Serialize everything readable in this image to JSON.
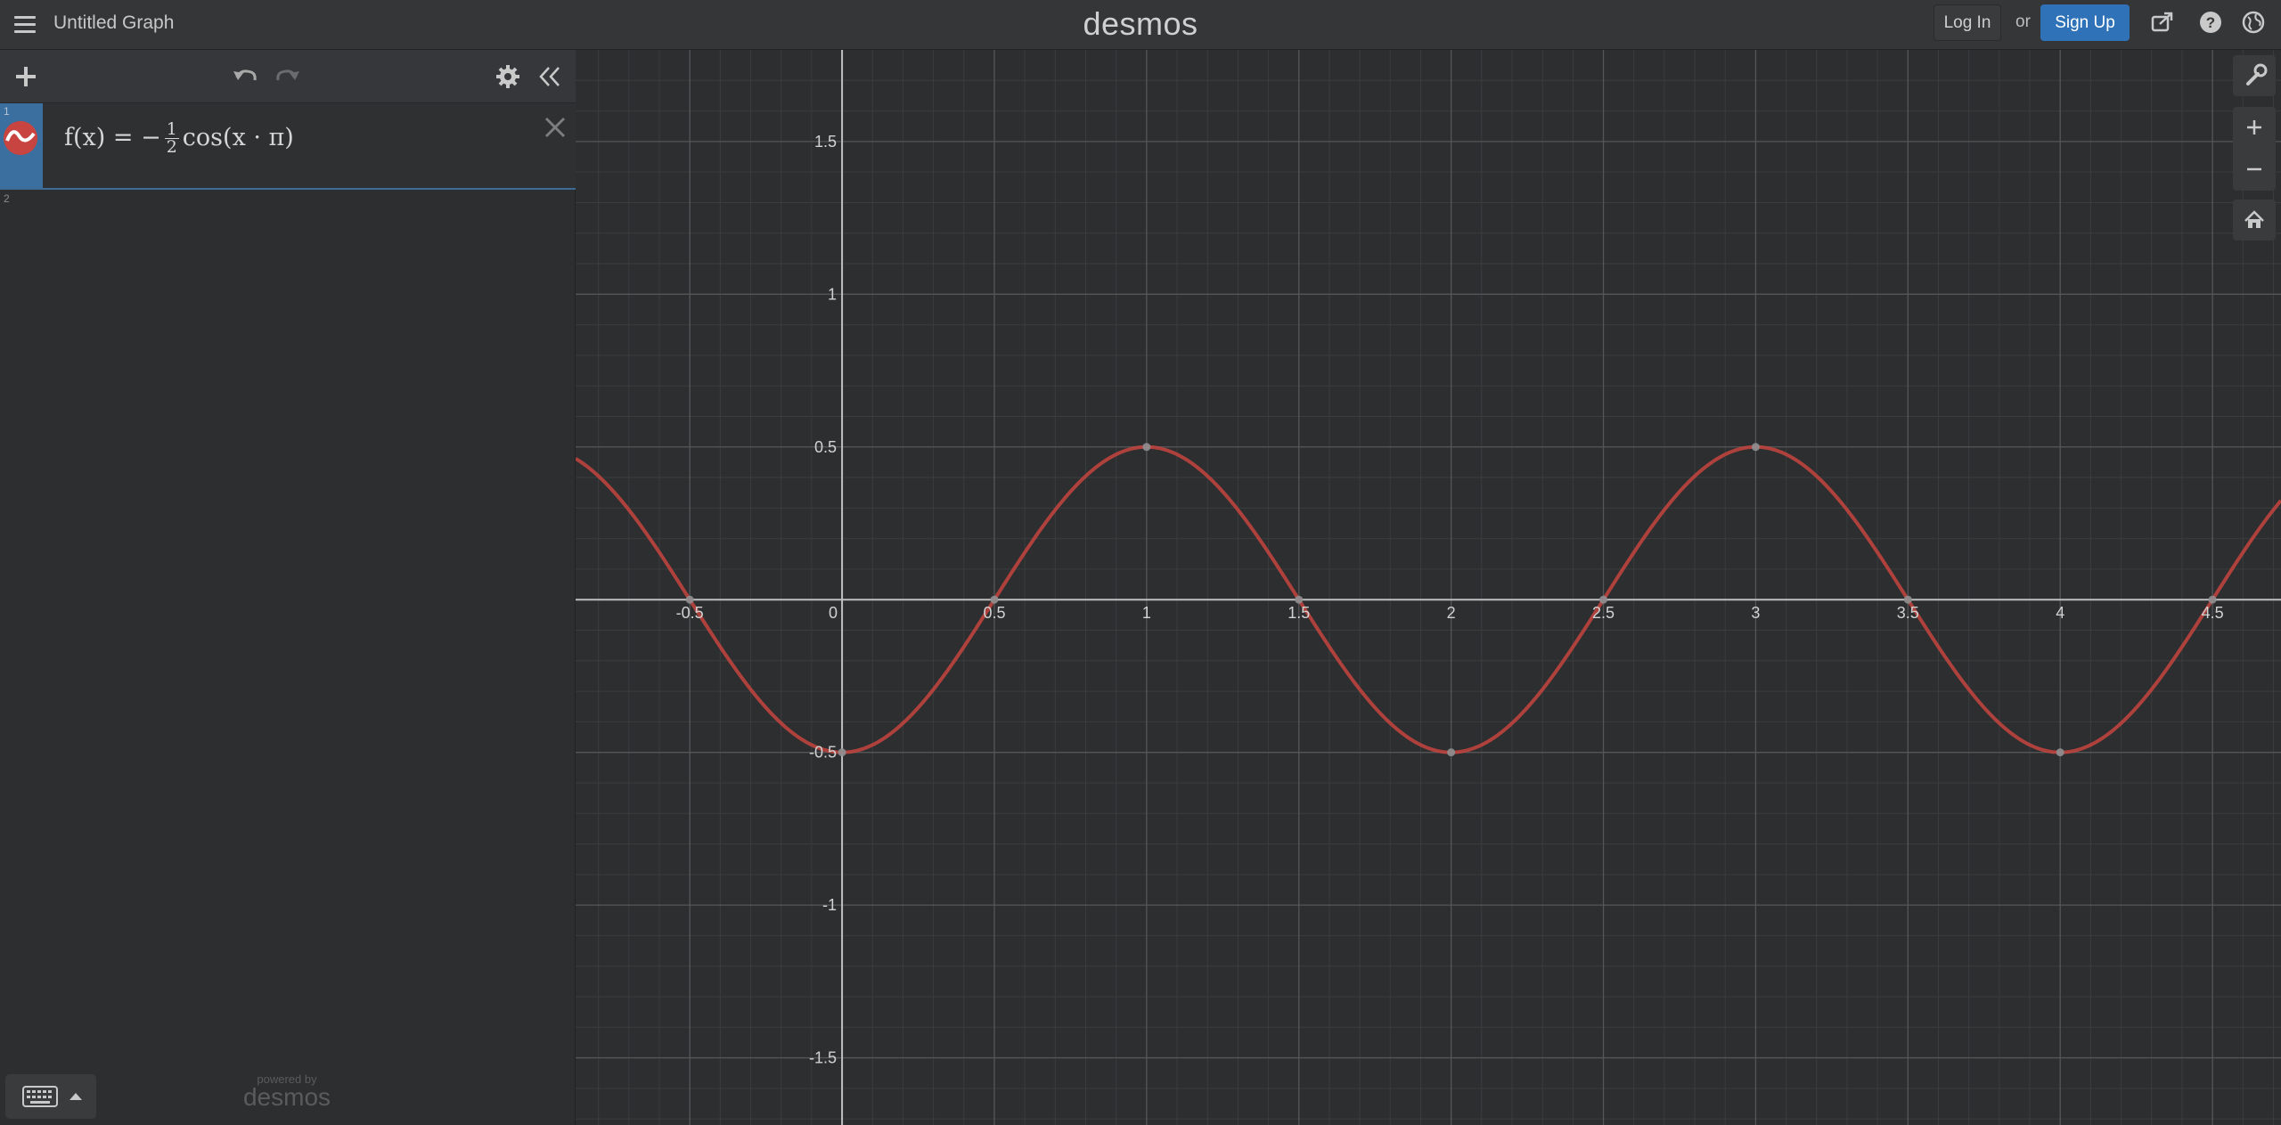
{
  "header": {
    "title": "Untitled Graph",
    "logo": "desmos",
    "login_label": "Log In",
    "or_label": "or",
    "signup_label": "Sign Up"
  },
  "expressions": [
    {
      "index": "1",
      "color": "#c74440",
      "latex_parts": {
        "lhs": "f(x) = −",
        "num": "1",
        "den": "2",
        "rhs": "cos(x · π)"
      }
    },
    {
      "index": "2"
    }
  ],
  "footer": {
    "powered_by": "powered by",
    "brand": "desmos"
  },
  "icons": {
    "menu": "hamburger-menu-icon",
    "share": "share-icon",
    "help": "help-icon",
    "language": "globe-icon",
    "add": "plus-icon",
    "undo": "undo-icon",
    "redo": "redo-icon",
    "settings": "gear-icon",
    "collapse": "double-chevron-left-icon",
    "delete": "close-icon",
    "keyboard": "keyboard-icon",
    "wrench": "wrench-icon",
    "zoom_in": "plus-icon",
    "zoom_out": "minus-icon",
    "home": "home-icon"
  },
  "chart_data": {
    "type": "line",
    "function": "f(x) = -1/2 cos(x·π)",
    "series": [
      {
        "name": "",
        "color": "#c74440",
        "x": [
          -0.875,
          -0.5,
          0,
          0.5,
          1,
          1.5,
          2,
          2.5,
          3,
          3.5,
          4,
          4.5,
          4.725
        ],
        "y": [
          0.462,
          0,
          -0.5,
          0,
          0.5,
          0,
          -0.5,
          0,
          0.5,
          0,
          -0.5,
          0,
          0.333
        ]
      }
    ],
    "highlighted_points": [
      {
        "x": -0.5,
        "y": 0
      },
      {
        "x": 0,
        "y": -0.5
      },
      {
        "x": 0.5,
        "y": 0
      },
      {
        "x": 1,
        "y": 0.5
      },
      {
        "x": 1.5,
        "y": 0
      },
      {
        "x": 2,
        "y": -0.5
      },
      {
        "x": 2.5,
        "y": 0
      },
      {
        "x": 3,
        "y": 0.5
      },
      {
        "x": 3.5,
        "y": 0
      },
      {
        "x": 4,
        "y": -0.5
      },
      {
        "x": 4.5,
        "y": 0
      }
    ],
    "x_ticks": [
      "-0.5",
      "0",
      "0.5",
      "1",
      "1.5",
      "2",
      "2.5",
      "3",
      "3.5",
      "4",
      "4.5"
    ],
    "y_ticks": [
      "1.5",
      "1",
      "0.5",
      "-0.5",
      "-1",
      "-1.5"
    ],
    "xlim": [
      -0.875,
      4.725
    ],
    "ylim": [
      -1.72,
      1.8
    ],
    "grid": true,
    "xlabel": "",
    "ylabel": ""
  }
}
